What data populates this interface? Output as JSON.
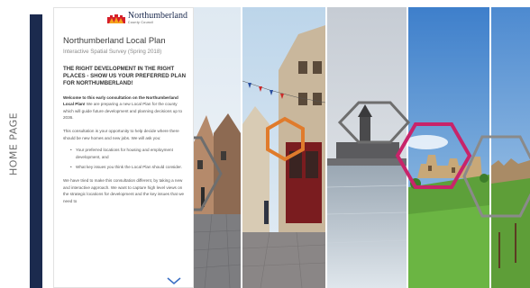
{
  "side_tab": {
    "label": "HOME PAGE"
  },
  "logo": {
    "name": "Northumberland",
    "subtitle": "County Council",
    "icon": "castle-crest-icon",
    "colors": {
      "red": "#d6202a",
      "orange": "#f4a21b"
    }
  },
  "panel": {
    "title": "Northumberland Local Plan",
    "subtitle": "Interactive Spatial Survey (Spring 2018)",
    "headline": "THE RIGHT DEVELOPMENT IN THE RIGHT PLACES - SHOW US YOUR PREFERRED PLAN FOR NORTHUMBERLAND!",
    "welcome_bold": "Welcome to this early consultation on the Northumberland Local Plan!",
    "welcome_rest": " We are preparing a new Local Plan for the county which will guide future development and planning decisions up to 2036.",
    "intro": "This consultation is your opportunity to help decide where there should be new homes and new jobs. We will ask you:",
    "bullets": [
      "Your preferred locations for housing and employment development, and",
      "What key issues you think the Local Plan should consider."
    ],
    "closing": "We have tried to make this consultation different, by taking a new and interactive approach. We want to capture high level views on the strategic locations for development and the key issues that we need to"
  },
  "hexagons": [
    {
      "name": "hexagon-outline-orange",
      "color": "#e07b2c"
    },
    {
      "name": "hexagon-outline-grey-left",
      "color": "#6e6e6e"
    },
    {
      "name": "hexagon-outline-grey-middle",
      "color": "#6e6e6e"
    },
    {
      "name": "hexagon-outline-magenta",
      "color": "#c8246a"
    },
    {
      "name": "hexagon-outline-grey-right",
      "color": "#8a8a8a"
    }
  ],
  "colors": {
    "navy": "#1b2a4e"
  }
}
